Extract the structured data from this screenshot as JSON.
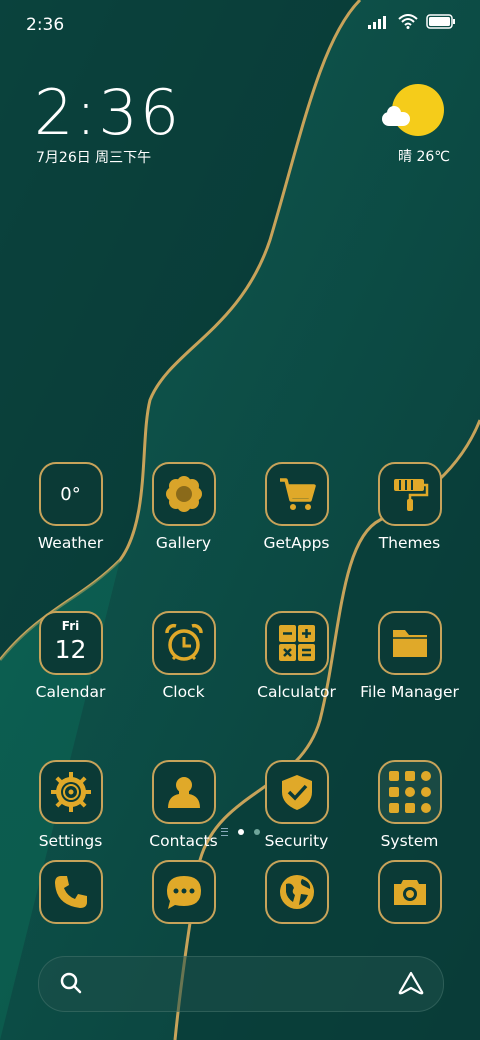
{
  "status_bar": {
    "time": "2:36"
  },
  "lockclock": {
    "time": "2:36",
    "date": "7月26日 周三下午"
  },
  "weather_widget": {
    "text": "晴 26℃"
  },
  "apps": [
    {
      "label": "Weather",
      "icon": "weather-icon",
      "icon_text": "0°"
    },
    {
      "label": "Gallery",
      "icon": "flower-icon"
    },
    {
      "label": "GetApps",
      "icon": "cart-icon"
    },
    {
      "label": "Themes",
      "icon": "paint-roller-icon"
    },
    {
      "label": "Calendar",
      "icon": "calendar-icon",
      "cal_day": "Fri",
      "cal_num": "12"
    },
    {
      "label": "Clock",
      "icon": "alarm-clock-icon"
    },
    {
      "label": "Calculator",
      "icon": "calculator-icon"
    },
    {
      "label": "File Manager",
      "icon": "folder-icon"
    },
    {
      "label": "Settings",
      "icon": "gear-icon"
    },
    {
      "label": "Contacts",
      "icon": "person-icon"
    },
    {
      "label": "Security",
      "icon": "shield-icon"
    },
    {
      "label": "System",
      "icon": "app-folder-icon"
    }
  ],
  "dock": [
    {
      "icon": "phone-icon"
    },
    {
      "icon": "message-icon"
    },
    {
      "icon": "browser-icon"
    },
    {
      "icon": "camera-icon"
    }
  ],
  "colors": {
    "accent": "#e0a929",
    "border": "#c7a35a",
    "icon_bg": "#0b3a36"
  }
}
